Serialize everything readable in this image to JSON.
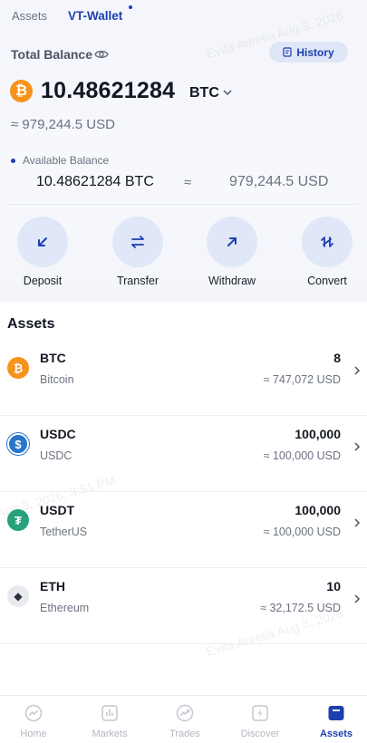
{
  "tabs": [
    {
      "label": "Assets"
    },
    {
      "label": "VT-Wallet"
    }
  ],
  "header": {
    "total_balance_label": "Total Balance",
    "history_label": "History",
    "balance_amount": "10.48621284",
    "balance_unit": "BTC",
    "approx_usd": "≈ 979,244.5 USD"
  },
  "available": {
    "label": "Available Balance",
    "btc": "10.48621284 BTC",
    "approx_symbol": "≈",
    "usd": "979,244.5 USD"
  },
  "actions": [
    {
      "label": "Deposit",
      "icon": "arrow-down-left-icon"
    },
    {
      "label": "Transfer",
      "icon": "swap-icon"
    },
    {
      "label": "Withdraw",
      "icon": "arrow-up-right-icon"
    },
    {
      "label": "Convert",
      "icon": "convert-icon"
    }
  ],
  "assets": {
    "title": "Assets",
    "items": [
      {
        "symbol": "BTC",
        "name": "Bitcoin",
        "amount": "8",
        "usd": "≈ 747,072 USD",
        "icon": "bitcoin-icon",
        "color": "#f7931a",
        "glyph": "₿"
      },
      {
        "symbol": "USDC",
        "name": "USDC",
        "amount": "100,000",
        "usd": "≈ 100,000 USD",
        "icon": "usdc-icon",
        "color": "#2775ca",
        "glyph": "$"
      },
      {
        "symbol": "USDT",
        "name": "TetherUS",
        "amount": "100,000",
        "usd": "≈ 100,000 USD",
        "icon": "tether-icon",
        "color": "#26a17b",
        "glyph": "₮"
      },
      {
        "symbol": "ETH",
        "name": "Ethereum",
        "amount": "10",
        "usd": "≈ 32,172.5 USD",
        "icon": "ethereum-icon",
        "color": "#e8eaf0",
        "glyph": "◆"
      }
    ]
  },
  "nav": [
    {
      "label": "Home",
      "icon": "home-chart-icon"
    },
    {
      "label": "Markets",
      "icon": "markets-icon"
    },
    {
      "label": "Trades",
      "icon": "trades-icon"
    },
    {
      "label": "Discover",
      "icon": "discover-icon"
    },
    {
      "label": "Assets",
      "icon": "assets-wallet-icon",
      "active": true
    }
  ],
  "watermarks": [
    "Evita Aurelia Aug 3, 2026",
    "Aug 3, 2026, 3:51 PM",
    "Evita Aurelia Aug 3, 2026"
  ],
  "colors": {
    "accent": "#1d3fb0",
    "action_bg": "#dfe7f8",
    "bitcoin": "#f7931a"
  }
}
